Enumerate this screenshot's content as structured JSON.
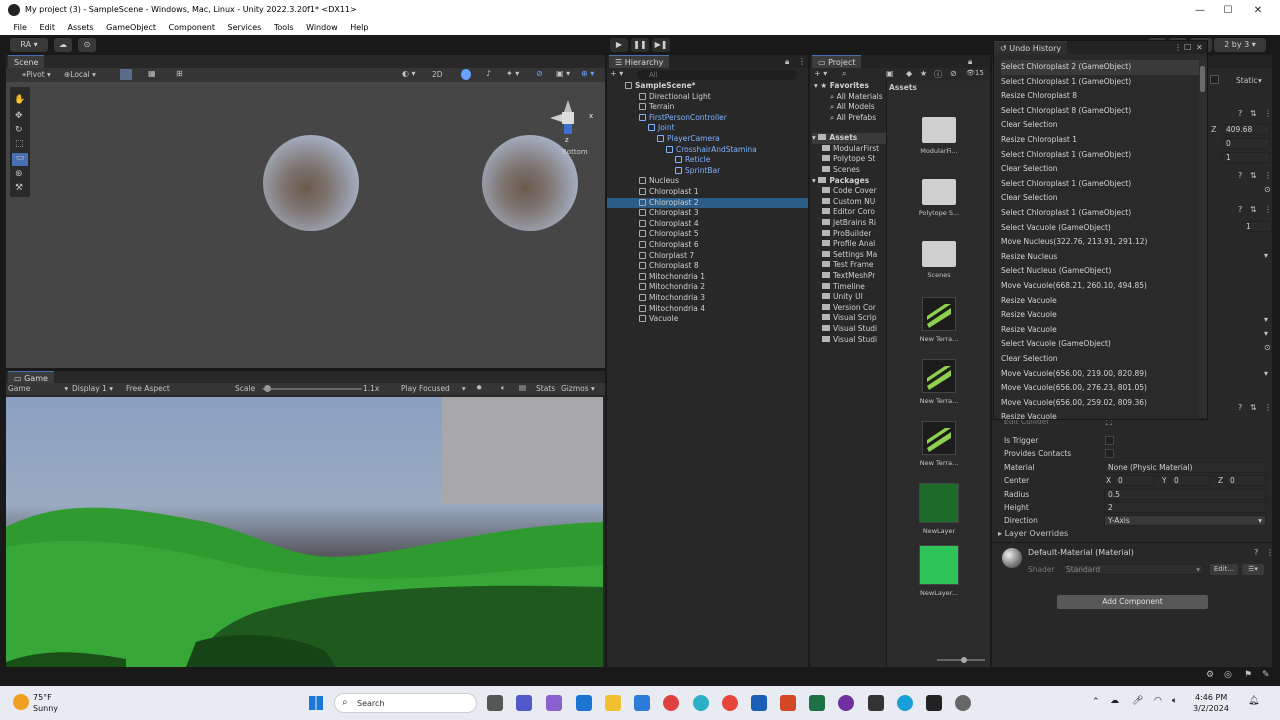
{
  "window": {
    "title": "My project (3) - SampleScene - Windows, Mac, Linux - Unity 2022.3.20f1* <DX11>",
    "minimize_glyph": "—",
    "maximize_glyph": "☐",
    "close_glyph": "✕"
  },
  "menu": [
    "File",
    "Edit",
    "Assets",
    "GameObject",
    "Component",
    "Services",
    "Tools",
    "Window",
    "Help"
  ],
  "toolbar": {
    "account": "RA",
    "layout": "2 by 3"
  },
  "scene": {
    "tab": "Scene",
    "pivot": "Pivot",
    "local": "Local",
    "mode_2d": "2D",
    "gizmo_label": "Bottom",
    "axis_x": "x",
    "axis_z": "z"
  },
  "game": {
    "tab": "Game",
    "mode": "Game",
    "display": "Display 1",
    "aspect": "Free Aspect",
    "scale_label": "Scale",
    "scale_value": "1.1x",
    "play_mode": "Play Focused",
    "stats": "Stats",
    "gizmos": "Gizmos"
  },
  "hierarchy": {
    "tab": "Hierarchy",
    "search_placeholder": "All",
    "rows": [
      {
        "label": "SampleScene*",
        "depth": 0,
        "bold": true
      },
      {
        "label": "Directional Light",
        "depth": 1
      },
      {
        "label": "Terrain",
        "depth": 1
      },
      {
        "label": "FirstPersonController",
        "depth": 1,
        "blue": true
      },
      {
        "label": "Joint",
        "depth": 2,
        "blue": true
      },
      {
        "label": "PlayerCamera",
        "depth": 3,
        "blue": true
      },
      {
        "label": "CrosshairAndStamina",
        "depth": 4,
        "blue": true
      },
      {
        "label": "Reticle",
        "depth": 5,
        "blue": true
      },
      {
        "label": "SprintBar",
        "depth": 5,
        "blue": true
      },
      {
        "label": "Nucleus",
        "depth": 1
      },
      {
        "label": "Chloroplast 1",
        "depth": 1
      },
      {
        "label": "Chloroplast 2",
        "depth": 1,
        "selected": true
      },
      {
        "label": "Chloroplast 3",
        "depth": 1
      },
      {
        "label": "Chloroplast 4",
        "depth": 1
      },
      {
        "label": "Chloroplast 5",
        "depth": 1
      },
      {
        "label": "Chloroplast 6",
        "depth": 1
      },
      {
        "label": "Chlorplast 7",
        "depth": 1
      },
      {
        "label": "Chloroplast 8",
        "depth": 1
      },
      {
        "label": "Mitochondria 1",
        "depth": 1
      },
      {
        "label": "Mitochondria 2",
        "depth": 1
      },
      {
        "label": "Mitochondria 3",
        "depth": 1
      },
      {
        "label": "Mitochondria 4",
        "depth": 1
      },
      {
        "label": "Vacuole",
        "depth": 1
      }
    ]
  },
  "project": {
    "tab": "Project",
    "favorites_header": "Favorites",
    "favorites": [
      "All Materials",
      "All Models",
      "All Prefabs"
    ],
    "assets_header": "Assets",
    "assets_folders": [
      "ModularFirst",
      "Polytope St",
      "Scenes"
    ],
    "packages_header": "Packages",
    "packages": [
      "Code Cover",
      "Custom NU",
      "Editor Coro",
      "JetBrains Ri",
      "ProBuilder",
      "Profile Anal",
      "Settings Ma",
      "Test Frame",
      "TextMeshPr",
      "Timeline",
      "Unity UI",
      "Version Cor",
      "Visual Scrip",
      "Visual Studi",
      "Visual Studi"
    ],
    "grid_header": "Assets",
    "count_badge": "15",
    "grid": [
      {
        "label": "ModularFi...",
        "kind": "folder"
      },
      {
        "label": "Polytope S...",
        "kind": "folder"
      },
      {
        "label": "Scenes",
        "kind": "folder"
      },
      {
        "label": "New Terra...",
        "kind": "terrain"
      },
      {
        "label": "New Terra...",
        "kind": "terrain"
      },
      {
        "label": "New Terra...",
        "kind": "terrain"
      },
      {
        "label": "NewLayer",
        "kind": "layer"
      },
      {
        "label": "NewLayer...",
        "kind": "layer"
      }
    ]
  },
  "undo": {
    "tab": "Undo History",
    "items": [
      "Select Chloroplast 2 (GameObject)",
      "Select Chloroplast 1 (GameObject)",
      "Resize Chloroplast 8",
      "Select Chloroplast 8 (GameObject)",
      "Clear Selection",
      "Resize Chloroplast 1",
      "Select Chloroplast 1 (GameObject)",
      "Clear Selection",
      "Select Chloroplast 1 (GameObject)",
      "Clear Selection",
      "Select Chloroplast 1 (GameObject)",
      "Select Vacuole (GameObject)",
      "Move Nucleus(322.76, 213.91, 291.12)",
      "Resize Nucleus",
      "Select Nucleus (GameObject)",
      "Move Vacuole(668.21, 260.10, 494.85)",
      "Resize Vacuole",
      "Resize Vacuole",
      "Resize Vacuole",
      "Select Vacuole (GameObject)",
      "Clear Selection",
      "Move Vacuole(656.00, 219.00, 820.89)",
      "Move Vacuole(656.00, 276.23, 801.05)",
      "Move Vacuole(656.00, 259.02, 809.36)",
      "Resize Vacuole"
    ]
  },
  "inspector": {
    "static_label": "Static",
    "z_label": "Z",
    "pos_z": "409.68",
    "rot_z": "0",
    "scale_z": "1",
    "edit_collider": "Edit Collider",
    "is_trigger": "Is Trigger",
    "provides_contacts": "Provides Contacts",
    "material_label": "Material",
    "material_value": "None (Physic Material)",
    "center_label": "Center",
    "cx_label": "X",
    "cx": "0",
    "cy_label": "Y",
    "cy": "0",
    "cz_label": "Z",
    "cz": "0",
    "radius_label": "Radius",
    "radius": "0.5",
    "height_label": "Height",
    "height": "2",
    "direction_label": "Direction",
    "direction": "Y-Axis",
    "layer_overrides": "Layer Overrides",
    "material_name": "Default-Material (Material)",
    "shader_label": "Shader",
    "shader_value": "Standard",
    "edit_button": "Edit...",
    "add_component": "Add Component",
    "count_field": "1"
  },
  "taskbar": {
    "temp": "75°F",
    "weather": "Sunny",
    "search_placeholder": "Search",
    "time": "4:46 PM",
    "date": "3/2/2024"
  }
}
